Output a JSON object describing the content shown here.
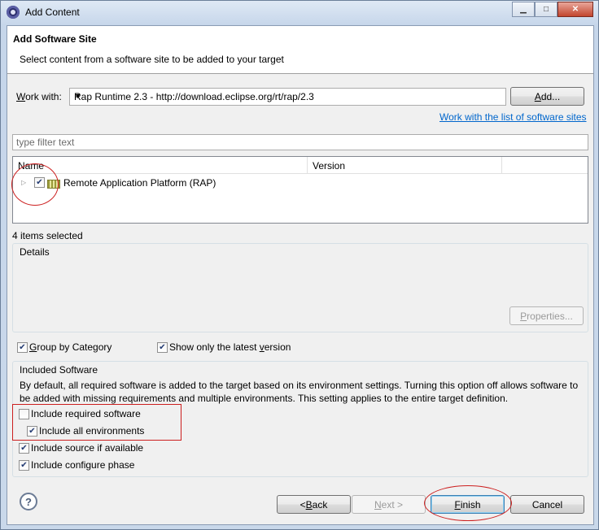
{
  "window": {
    "title": "Add Content",
    "minimize": "▁",
    "maximize": "□",
    "close": "✕"
  },
  "header": {
    "title": "Add Software Site",
    "description": "Select content from a software site to be added to your target"
  },
  "work_with": {
    "label": "Work with:",
    "value": "Rap Runtime 2.3 - http://download.eclipse.org/rt/rap/2.3",
    "add_button": "Add...",
    "link": "Work with the list of software sites"
  },
  "filter": {
    "placeholder": "type filter text"
  },
  "tree": {
    "columns": [
      "Name",
      "Version"
    ],
    "rows": [
      {
        "label": "Remote Application Platform (RAP)",
        "checked": true,
        "version": ""
      }
    ]
  },
  "selection_status": "4 items selected",
  "details": {
    "label": "Details",
    "properties_button": "Properties..."
  },
  "options": {
    "group_by_category": {
      "label": "Group by Category",
      "checked": true
    },
    "show_latest": {
      "label": "Show only the latest version",
      "checked": true
    }
  },
  "included_software": {
    "title": "Included Software",
    "description": "By default, all required software is added to the target based on its environment settings. Turning this option off allows software to be added with missing requirements and multiple environments.  This setting applies to the entire target definition.",
    "include_required": {
      "label": "Include required software",
      "checked": false
    },
    "include_all_env": {
      "label": "Include all environments",
      "checked": true
    },
    "include_source": {
      "label": "Include source if available",
      "checked": true
    },
    "include_configure": {
      "label": "Include configure phase",
      "checked": true
    }
  },
  "footer": {
    "help": "?",
    "back": "< Back",
    "next": "Next >",
    "finish": "Finish",
    "cancel": "Cancel"
  },
  "colors": {
    "annotation": "#cc1f1f",
    "link": "#0066cc"
  }
}
